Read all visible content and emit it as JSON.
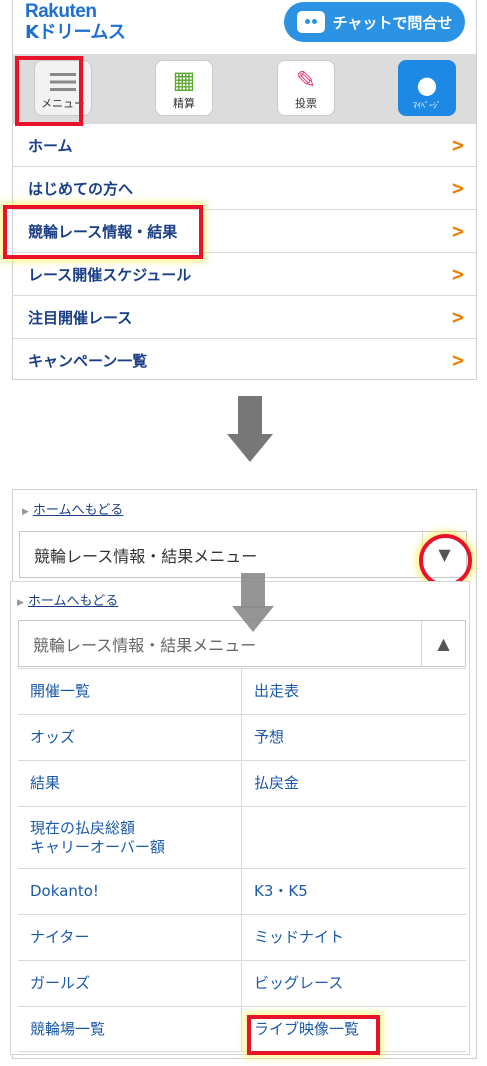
{
  "header": {
    "logo_line1": "Rakuten",
    "logo_line2": "Kドリームス",
    "chat_label": "チャットで問合せ"
  },
  "iconbar": {
    "menu_label": "メニュー",
    "calc_label": "精算",
    "vote_label": "投票",
    "mypage_label": "ﾏｲﾍﾟｰｼﾞ"
  },
  "nav": {
    "items": [
      {
        "label": "ホーム"
      },
      {
        "label": "はじめての方へ"
      },
      {
        "label": "競輪レース情報・結果"
      },
      {
        "label": "レース開催スケジュール"
      },
      {
        "label": "注目開催レース"
      },
      {
        "label": "キャンペーン一覧"
      }
    ],
    "chevron": ">"
  },
  "submenu": {
    "back_label": "ホームへもどる",
    "select_label": "競輪レース情報・結果メニュー",
    "rows": [
      [
        "開催一覧",
        "出走表"
      ],
      [
        "オッズ",
        "予想"
      ],
      [
        "結果",
        "払戻金"
      ],
      [
        "現在の払戻総額\nキャリーオーバー額",
        ""
      ],
      [
        "Dokanto!",
        "K3・K5"
      ],
      [
        "ナイター",
        "ミッドナイト"
      ],
      [
        "ガールズ",
        "ビッグレース"
      ],
      [
        "競輪場一覧",
        "ライブ映像一覧"
      ]
    ]
  },
  "colors": {
    "brand_blue": "#1e6fd1",
    "chat_blue": "#2b92e4",
    "link_navy": "#1b3f86",
    "chevron_orange": "#f07d00",
    "highlight_red": "#e8132b"
  }
}
